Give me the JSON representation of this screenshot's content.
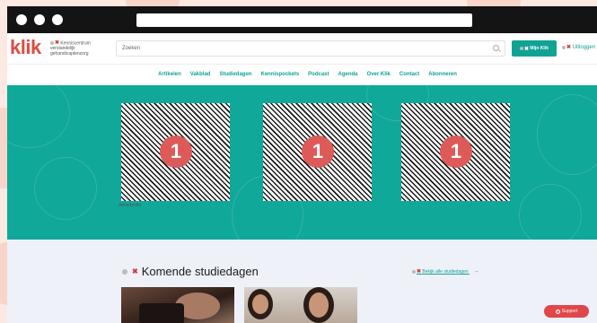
{
  "header": {
    "logo_text": "klik",
    "tagline": "Kenniscentrum verstandelijk gehandicaptenzorg",
    "search_placeholder": "Zoeken",
    "mijn_klik_label": "Mijn Klik",
    "uitloggen_label": "Uitloggen"
  },
  "nav": {
    "items": [
      "Artikelen",
      "Vakblad",
      "Studiedagen",
      "Kennispockets",
      "Podcast",
      "Agenda",
      "Over Klik",
      "Contact",
      "Abonneren"
    ]
  },
  "hero": {
    "tiles": [
      {
        "badge": "1"
      },
      {
        "badge": "1"
      },
      {
        "badge": "1"
      }
    ],
    "caption": "Advertentie"
  },
  "section": {
    "title": "Komende studiedagen",
    "see_all_label": "Bekijk alle studiedagen",
    "arrow": "→"
  },
  "support": {
    "icon": "?",
    "label": "Support"
  },
  "colors": {
    "brand_red": "#e04b43",
    "teal": "#10a394",
    "hero_teal": "#10a899",
    "support_red": "#e0464a"
  },
  "icons": [
    "search-icon",
    "flag-icon",
    "x-icon",
    "arrow-right-icon",
    "help-icon"
  ]
}
